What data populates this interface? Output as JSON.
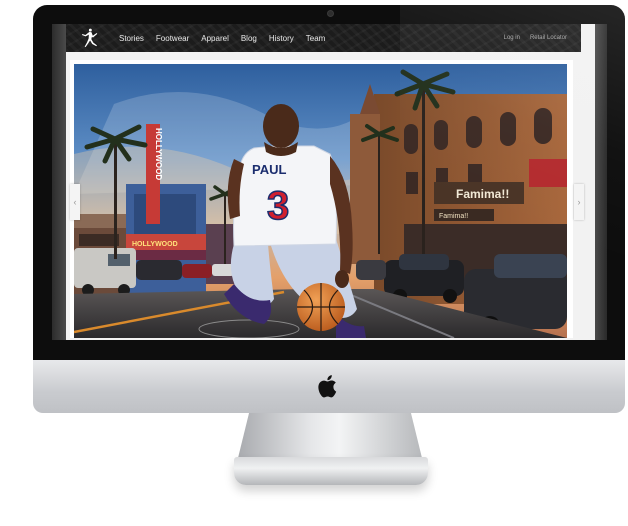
{
  "nav": {
    "brand_icon": "jumpman-logo-icon",
    "links": [
      "Stories",
      "Footwear",
      "Apparel",
      "Blog",
      "History",
      "Team"
    ],
    "right_links": [
      "Log in",
      "Retail Locator"
    ]
  },
  "hero": {
    "jersey_name": "PAUL",
    "jersey_number": "3",
    "sign_vertical": "HOLLYWOOD",
    "marquee": "HOLLYWOOD",
    "store_sign": "Famima!!",
    "store_sign_small": "Famima!!",
    "ball_icon": "basketball-icon"
  },
  "controls": {
    "prev_icon": "chevron-left-icon",
    "next_icon": "chevron-right-icon",
    "prev_glyph": "‹",
    "next_glyph": "›"
  },
  "device": {
    "logo_icon": "apple-logo-icon"
  },
  "colors": {
    "nav_bg": "#1c1c1c",
    "jersey_red": "#d0202f",
    "sky_blue": "#3f78b8",
    "bezel": "#0d0d0d"
  }
}
